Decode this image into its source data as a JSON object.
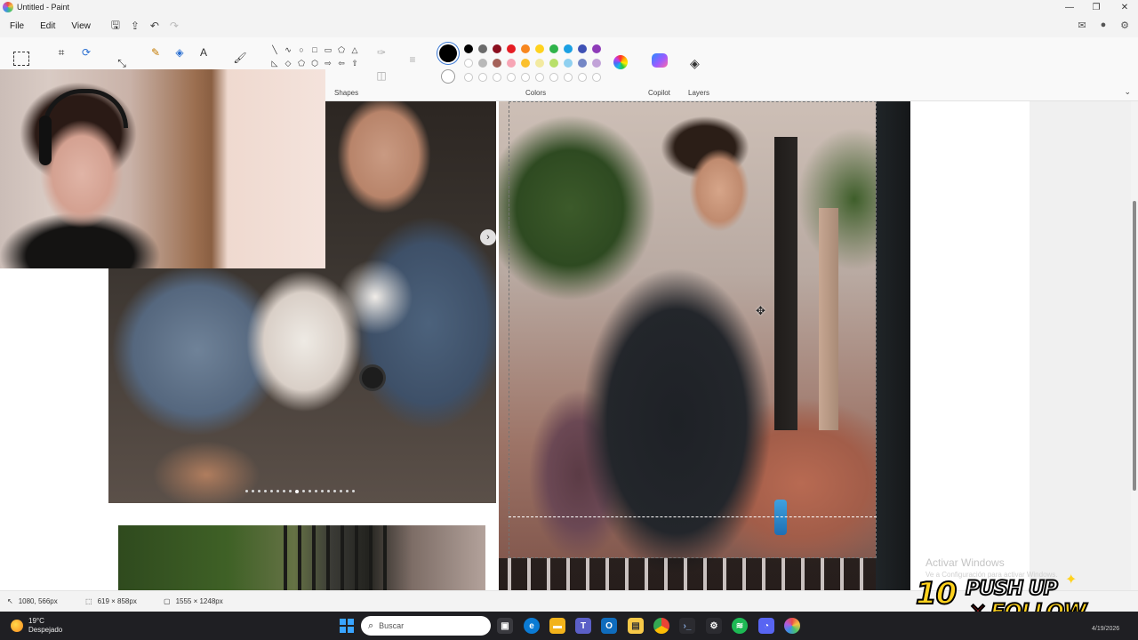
{
  "window": {
    "title": "Untitled - Paint",
    "controls": [
      "minimize",
      "maximize",
      "close"
    ]
  },
  "menu": {
    "file": "File",
    "edit": "Edit",
    "view": "View"
  },
  "ribbon": {
    "groups": {
      "shapes": "Shapes",
      "colors": "Colors",
      "copilot": "Copilot",
      "layers": "Layers"
    },
    "primary_color": "#000000",
    "secondary_color": "#ffffff",
    "swatches_row1": [
      "#000000",
      "#6b6b6b",
      "#8b0f1f",
      "#e51c23",
      "#f7861e",
      "#ffd21e",
      "#2fb34a",
      "#1ba0e3",
      "#3f51b5",
      "#8e3bb8"
    ],
    "swatches_row2": [
      "#ffffff",
      "#b9b9b9",
      "#a5625a",
      "#f7a5b5",
      "#fbc02d",
      "#f3eaa0",
      "#b8e06a",
      "#8fd0f0",
      "#7587c6",
      "#c2a3d8"
    ]
  },
  "canvas": {
    "carousel_arrow": "›",
    "carousel_dot_count": 18,
    "carousel_active_dot": 8,
    "watermark_title": "Activar Windows",
    "watermark_sub": "Ve a Configuración para activar Windows."
  },
  "statusbar": {
    "cursor_pos": "1080, 566px",
    "selection_size": "619 × 858px",
    "canvas_size": "1555 × 1248px"
  },
  "overlay": {
    "number": "10",
    "line1": "PUSH UP",
    "x": "✕",
    "line2": "FOLLOW"
  },
  "taskbar": {
    "temperature": "19°C",
    "weather": "Despejado",
    "search_placeholder": "Buscar",
    "date": "4/19/2026"
  }
}
